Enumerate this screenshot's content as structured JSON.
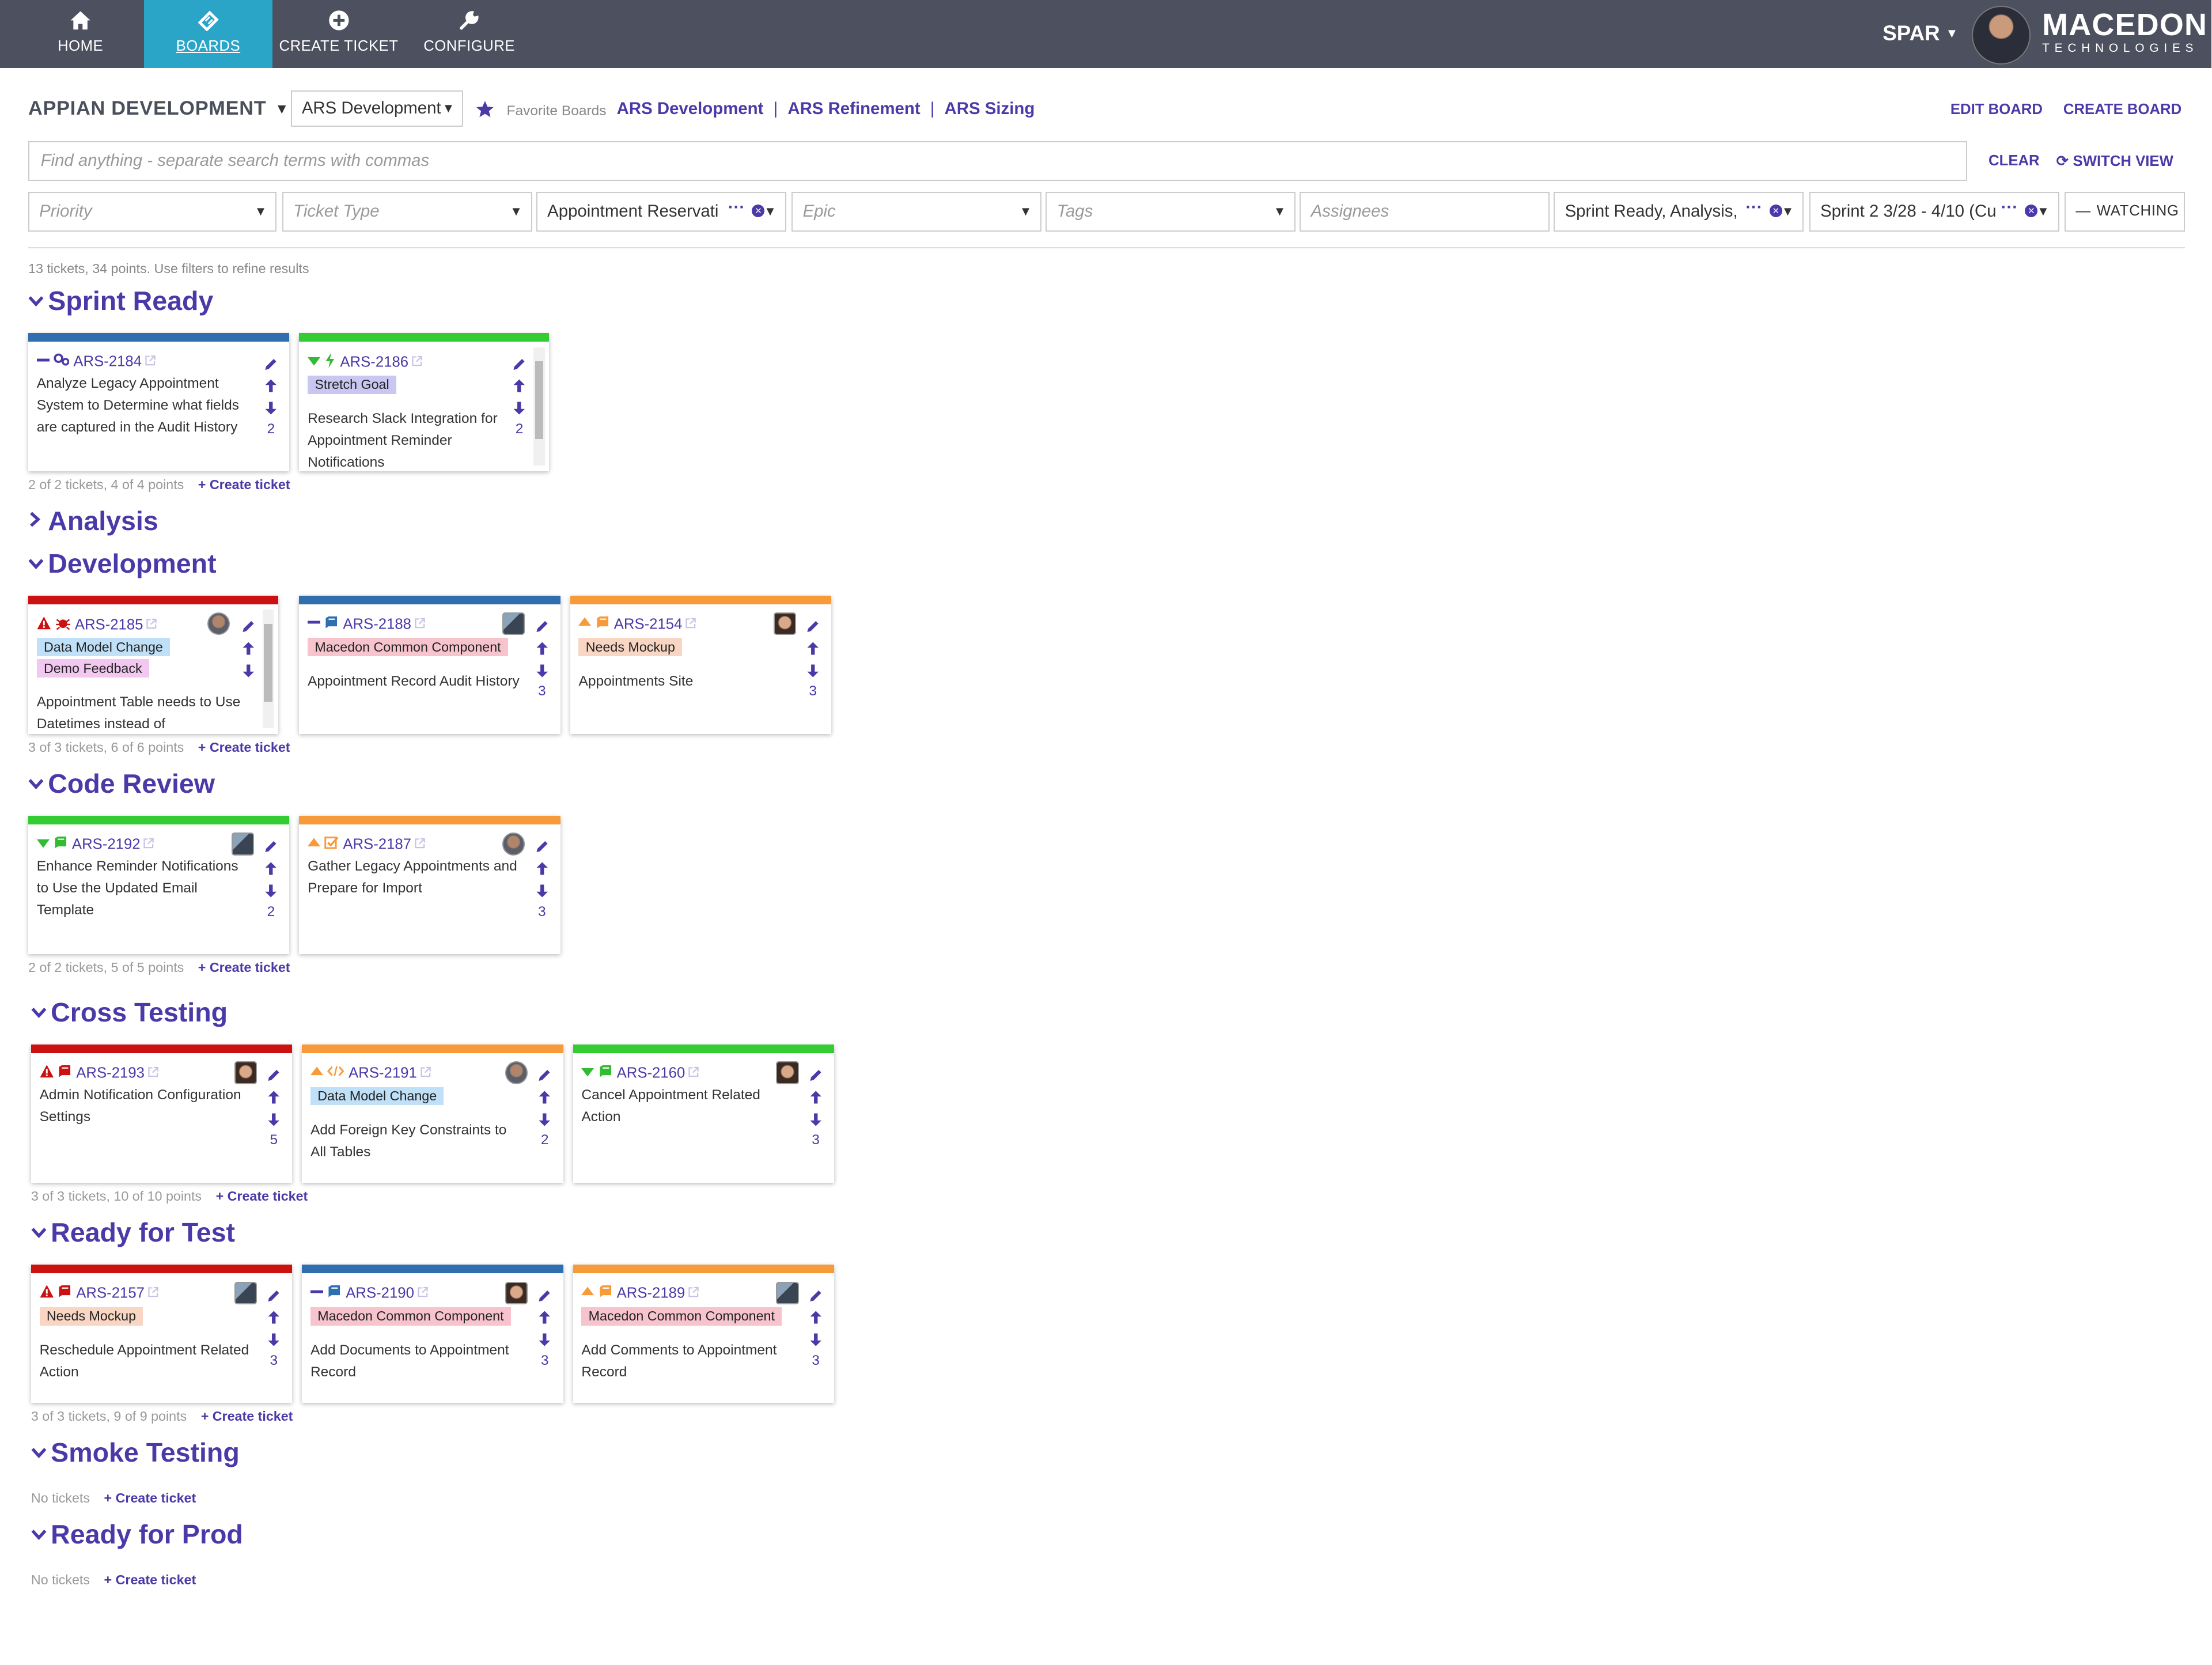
{
  "nav": {
    "items": [
      {
        "label": "HOME",
        "icon": "home-icon"
      },
      {
        "label": "BOARDS",
        "icon": "ticket-icon",
        "active": true
      },
      {
        "label": "CREATE TICKET",
        "icon": "plus-circle-icon"
      },
      {
        "label": "CONFIGURE",
        "icon": "wrench-icon"
      }
    ],
    "user": "SPAR",
    "logo_line1": "MACEDON",
    "logo_line2": "TECHNOLOGIES"
  },
  "header": {
    "board_title": "APPIAN DEVELOPMENT",
    "board_select": "ARS Development",
    "favorite_label": "Favorite Boards",
    "favorites": [
      "ARS Development",
      "ARS Refinement",
      "ARS Sizing"
    ],
    "edit_board": "EDIT BOARD",
    "create_board": "CREATE BOARD"
  },
  "search": {
    "placeholder": "Find anything - separate search terms with commas",
    "clear": "CLEAR",
    "switch_view": "SWITCH VIEW"
  },
  "filters": {
    "priority": "Priority",
    "ticket_type": "Ticket Type",
    "epic_value": "Appointment Reservati",
    "epic": "Epic",
    "tags": "Tags",
    "assignees": "Assignees",
    "status_value": "Sprint Ready, Analysis,",
    "sprint_value": "Sprint 2 3/28 - 4/10 (Cu",
    "watching": "WATCHING"
  },
  "summary": "13 tickets, 34 points. Use filters to refine results",
  "create_ticket": "+ Create ticket",
  "colors": {
    "accent": "#4a3aa8",
    "nav_bg": "#4c505f",
    "nav_active": "#2aa4c7",
    "red": "#cc1111",
    "blue": "#2f6fb0",
    "green": "#33cc33",
    "orange": "#f79a3a"
  },
  "sections": [
    {
      "title": "Sprint Ready",
      "expanded": true,
      "footer": "2 of 2 tickets, 4 of 4 points",
      "cards": [
        {
          "id": "ARS-2184",
          "color": "#2f6fb0",
          "priority": "dash",
          "type": "gears",
          "tags": [],
          "title": "Analyze Legacy Appointment System to Determine what fields are captured in the Audit History",
          "points": "2",
          "avatar": ""
        },
        {
          "id": "ARS-2186",
          "color": "#33cc33",
          "priority": "down",
          "type": "bolt",
          "tags": [
            {
              "t": "Stretch Goal",
              "c": "#c9c6f2"
            }
          ],
          "title": "Research Slack Integration for Appointment Reminder Notifications",
          "points": "2",
          "avatar": "",
          "scroll": true
        }
      ]
    },
    {
      "title": "Analysis",
      "expanded": false,
      "footer": "",
      "cards": []
    },
    {
      "title": "Development",
      "expanded": true,
      "footer": "3 of 3 tickets, 6 of 6 points",
      "cards": [
        {
          "id": "ARS-2185",
          "color": "#cc1111",
          "priority": "warn",
          "type": "bug",
          "tags": [
            {
              "t": "Data Model Change",
              "c": "#bfe0f7"
            },
            {
              "t": "Demo Feedback",
              "c": "#f2c8f0"
            }
          ],
          "title": "Appointment Table needs to Use Datetimes instead of",
          "points": "",
          "avatar": "round",
          "scroll": true
        },
        {
          "id": "ARS-2188",
          "color": "#2f6fb0",
          "priority": "dash",
          "type": "book",
          "tags": [
            {
              "t": "Macedon Common Component",
              "c": "#f7c3cd"
            }
          ],
          "title": "Appointment Record Audit History",
          "points": "3",
          "avatar": "square"
        },
        {
          "id": "ARS-2154",
          "color": "#f79a3a",
          "priority": "up",
          "type": "book-orange",
          "tags": [
            {
              "t": "Needs Mockup",
              "c": "#f9d6c4"
            }
          ],
          "title": "Appointments Site",
          "points": "3",
          "avatar": "woman"
        }
      ]
    },
    {
      "title": "Code Review",
      "expanded": true,
      "footer": "2 of 2 tickets, 5 of 5 points",
      "cards": [
        {
          "id": "ARS-2192",
          "color": "#33cc33",
          "priority": "down",
          "type": "book-green",
          "tags": [],
          "title": "Enhance Reminder Notifications to Use the Updated Email Template",
          "points": "2",
          "avatar": "square"
        },
        {
          "id": "ARS-2187",
          "color": "#f79a3a",
          "priority": "up",
          "type": "check",
          "tags": [],
          "title": "Gather Legacy Appointments and Prepare for Import",
          "points": "3",
          "avatar": "round"
        }
      ]
    },
    {
      "title": "Cross Testing",
      "expanded": true,
      "footer": "3 of 3 tickets, 10 of 10 points",
      "cards": [
        {
          "id": "ARS-2193",
          "color": "#cc1111",
          "priority": "warn",
          "type": "book-red",
          "tags": [],
          "title": "Admin Notification Configuration Settings",
          "points": "5",
          "avatar": "woman"
        },
        {
          "id": "ARS-2191",
          "color": "#f79a3a",
          "priority": "up",
          "type": "code",
          "tags": [
            {
              "t": "Data Model Change",
              "c": "#bfe0f7"
            }
          ],
          "title": "Add Foreign Key Constraints to All Tables",
          "points": "2",
          "avatar": "round"
        },
        {
          "id": "ARS-2160",
          "color": "#33cc33",
          "priority": "down",
          "type": "book-green",
          "tags": [],
          "title": "Cancel Appointment Related Action",
          "points": "3",
          "avatar": "woman"
        }
      ]
    },
    {
      "title": "Ready for Test",
      "expanded": true,
      "footer": "3 of 3 tickets, 9 of 9 points",
      "cards": [
        {
          "id": "ARS-2157",
          "color": "#cc1111",
          "priority": "warn",
          "type": "book-red",
          "tags": [
            {
              "t": "Needs Mockup",
              "c": "#f9d6c4"
            }
          ],
          "title": "Reschedule Appointment Related Action",
          "points": "3",
          "avatar": "square"
        },
        {
          "id": "ARS-2190",
          "color": "#2f6fb0",
          "priority": "dash",
          "type": "book",
          "tags": [
            {
              "t": "Macedon Common Component",
              "c": "#f7c3cd"
            }
          ],
          "title": "Add Documents to Appointment Record",
          "points": "3",
          "avatar": "woman"
        },
        {
          "id": "ARS-2189",
          "color": "#f79a3a",
          "priority": "up",
          "type": "book-orange",
          "tags": [
            {
              "t": "Macedon Common Component",
              "c": "#f7c3cd"
            }
          ],
          "title": "Add Comments to Appointment Record",
          "points": "3",
          "avatar": "square"
        }
      ]
    },
    {
      "title": "Smoke Testing",
      "expanded": true,
      "footer": "No tickets",
      "cards": []
    },
    {
      "title": "Ready for Prod",
      "expanded": true,
      "footer": "No tickets",
      "cards": []
    }
  ]
}
